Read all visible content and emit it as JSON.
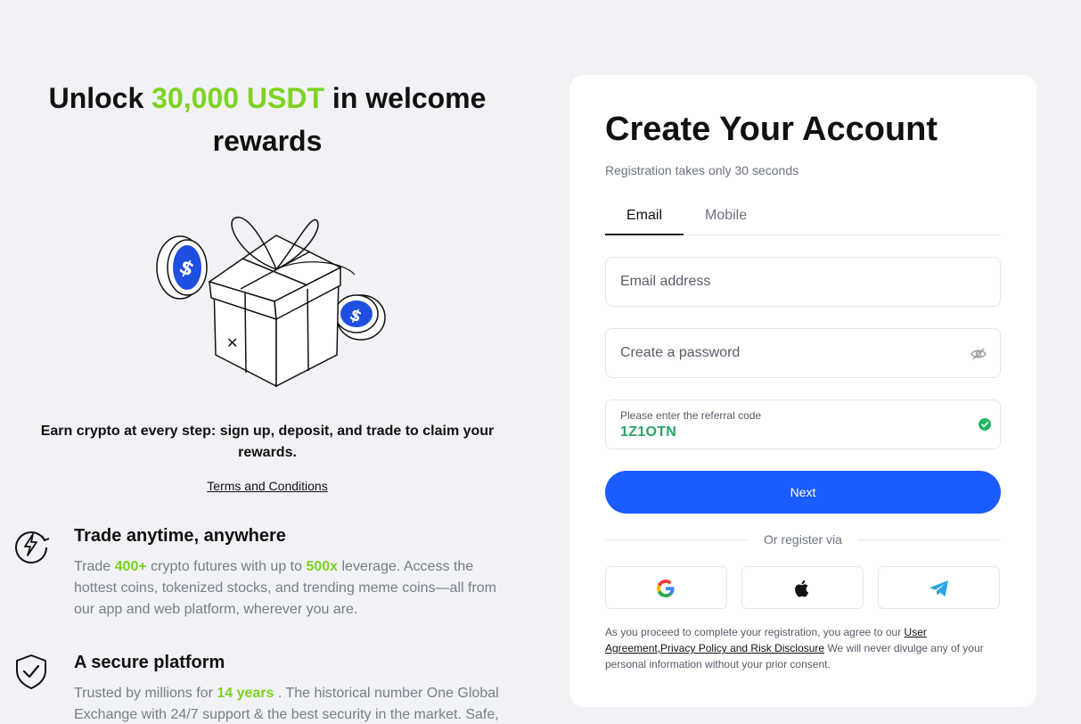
{
  "promo": {
    "headline_pre": "Unlock ",
    "headline_highlight": "30,000 USDT",
    "headline_post": " in welcome rewards",
    "earn_text": "Earn crypto at every step: sign up, deposit, and trade to claim your rewards.",
    "terms_link": "Terms and Conditions"
  },
  "features": [
    {
      "icon": "clock-lightning-icon",
      "title": "Trade anytime, anywhere",
      "desc_1": "Trade ",
      "hl_1": "400+",
      "desc_2": " crypto futures with up to ",
      "hl_2": "500x",
      "desc_3": " leverage. Access the hottest coins, tokenized stocks, and trending meme coins—all from our app and web platform, wherever you are."
    },
    {
      "icon": "shield-check-icon",
      "title": "A secure platform",
      "desc_1": "Trusted by millions for ",
      "hl_1": "14 years",
      "desc_2": " . The historical number One Global Exchange with 24/7 support & the best security in the market. Safe,"
    }
  ],
  "form": {
    "title": "Create Your Account",
    "subtitle": "Registration takes only 30 seconds",
    "tabs": [
      "Email",
      "Mobile"
    ],
    "active_tab": "Email",
    "email_placeholder": "Email address",
    "password_placeholder": "Create a password",
    "referral_label": "Please enter the referral code",
    "referral_value": "1Z1OTN",
    "next_label": "Next",
    "or_register": "Or register via",
    "social": [
      "google-icon",
      "apple-icon",
      "telegram-icon"
    ],
    "legal_pre": "As you proceed to complete your registration, you agree to our ",
    "legal_link_1": "User Agreement",
    "legal_sep": ",",
    "legal_link_2": "Privacy Policy and Risk Disclosure",
    "legal_post": " We will never divulge any of your personal information without your prior consent."
  },
  "colors": {
    "accent_green": "#7ed321",
    "primary_blue": "#1a5cff",
    "success_green": "#23b160"
  }
}
